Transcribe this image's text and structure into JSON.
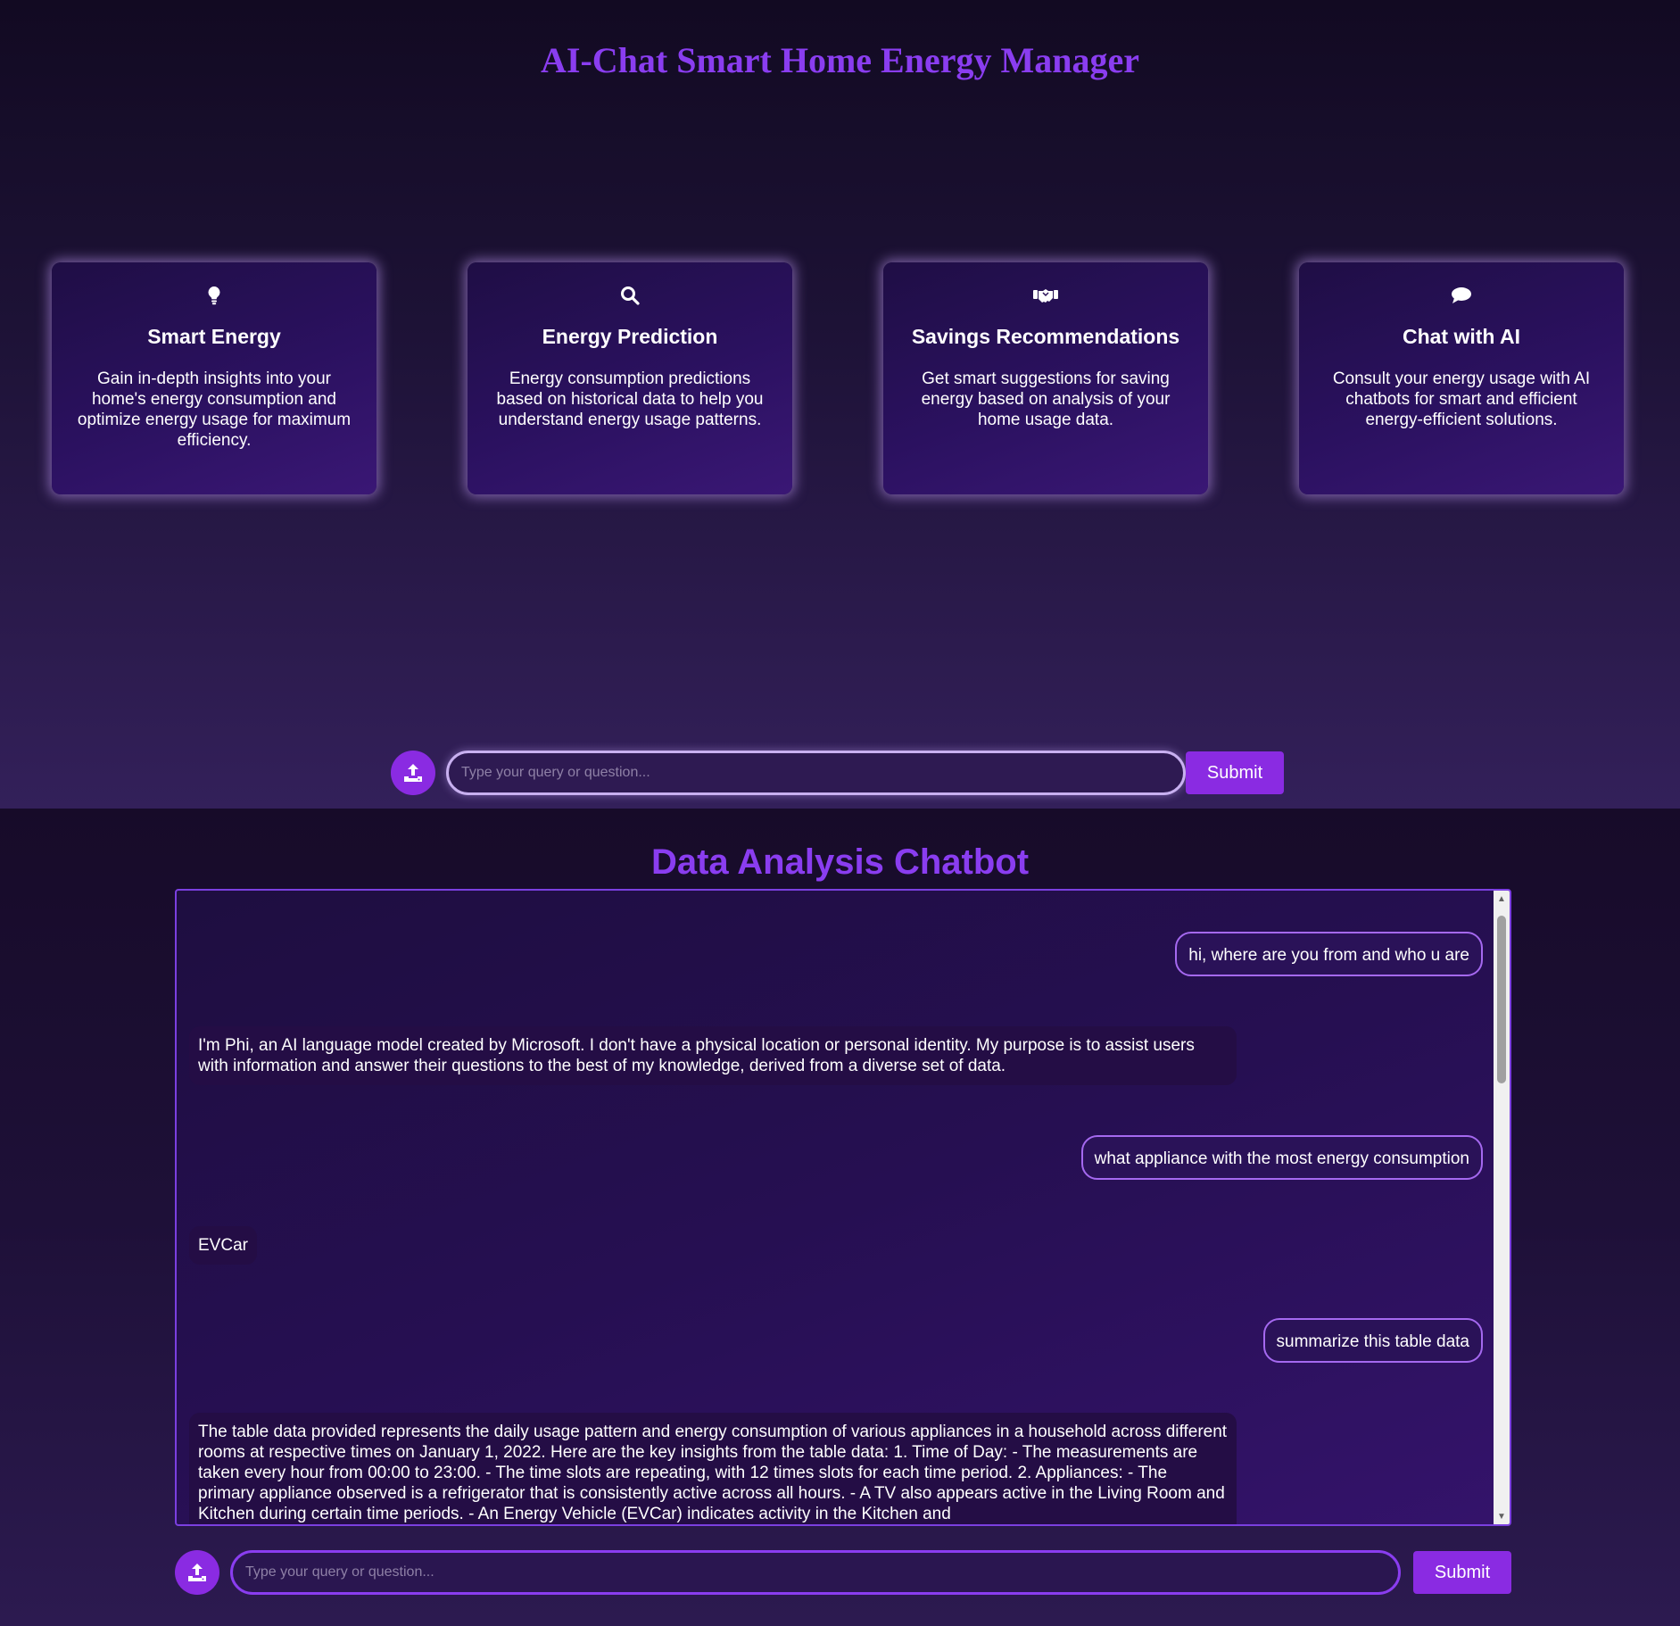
{
  "hero": {
    "title": "AI-Chat Smart Home Energy Manager",
    "cards": [
      {
        "icon": "lightbulb-icon",
        "title": "Smart Energy",
        "description": "Gain in-depth insights into your home's energy consumption and optimize energy usage for maximum efficiency."
      },
      {
        "icon": "search-icon",
        "title": "Energy Prediction",
        "description": "Energy consumption predictions based on historical data to help you understand energy usage patterns."
      },
      {
        "icon": "handshake-icon",
        "title": "Savings Recommendations",
        "description": "Get smart suggestions for saving energy based on analysis of your home usage data."
      },
      {
        "icon": "chat-bubble-icon",
        "title": "Chat with AI",
        "description": "Consult your energy usage with AI chatbots for smart and efficient energy-efficient solutions."
      }
    ],
    "query": {
      "placeholder": "Type your query or question...",
      "submit_label": "Submit",
      "upload_icon": "upload-icon"
    }
  },
  "chatbot": {
    "title": "Data Analysis Chatbot",
    "messages": [
      {
        "role": "user",
        "text": "hi, where are you from and who u are"
      },
      {
        "role": "bot",
        "text": "I'm Phi, an AI language model created by Microsoft. I don't have a physical location or personal identity. My purpose is to assist users with information and answer their questions to the best of my knowledge, derived from a diverse set of data."
      },
      {
        "role": "user",
        "text": "what appliance with the most energy consumption"
      },
      {
        "role": "bot",
        "text": "EVCar"
      },
      {
        "role": "user",
        "text": "summarize this table data"
      },
      {
        "role": "bot",
        "text": "The table data provided represents the daily usage pattern and energy consumption of various appliances in a household across different rooms at respective times on January 1, 2022. Here are the key insights from the table data: 1. Time of Day: - The measurements are taken every hour from 00:00 to 23:00. - The time slots are repeating, with 12 times slots for each time period. 2. Appliances: - The primary appliance observed is a refrigerator that is consistently active across all hours. - A TV also appears active in the Living Room and Kitchen during certain time periods. - An Energy Vehicle (EVCar) indicates activity in the Kitchen and"
      }
    ],
    "query": {
      "placeholder": "Type your query or question...",
      "submit_label": "Submit",
      "upload_icon": "upload-icon"
    }
  },
  "colors": {
    "accent": "#8a2be2",
    "title": "#8a3df0",
    "card_glow": "#c8a0ff"
  }
}
